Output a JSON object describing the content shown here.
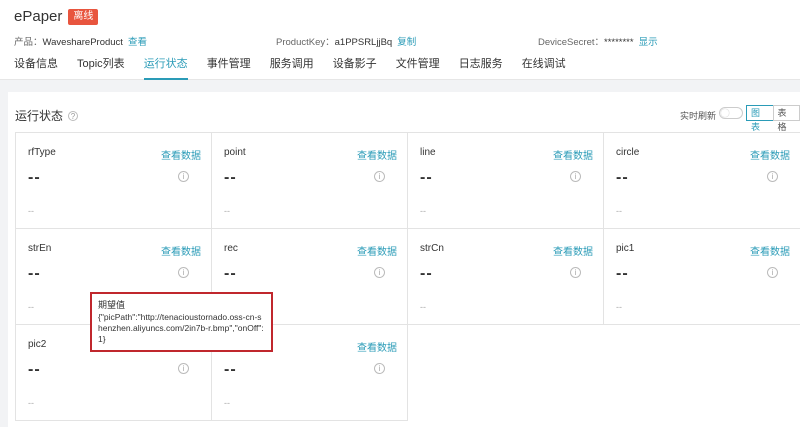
{
  "header": {
    "title": "ePaper",
    "badge": "离线",
    "product_label": "产品：",
    "product_value": "WaveshareProduct",
    "product_link": "查看",
    "productkey_label": "ProductKey：",
    "productkey_value": "a1PPSRLjjBq",
    "productkey_link": "复制",
    "secret_label": "DeviceSecret：",
    "secret_value": "********",
    "secret_link": "显示"
  },
  "tabs": [
    {
      "label": "设备信息"
    },
    {
      "label": "Topic列表"
    },
    {
      "label": "运行状态",
      "active": true
    },
    {
      "label": "事件管理"
    },
    {
      "label": "服务调用"
    },
    {
      "label": "设备影子"
    },
    {
      "label": "文件管理"
    },
    {
      "label": "日志服务"
    },
    {
      "label": "在线调试"
    }
  ],
  "section": {
    "title": "运行状态",
    "refresh_label": "实时刷新",
    "view_chart": "图表",
    "view_table": "表格"
  },
  "cards": [
    {
      "name": "rfType",
      "link": "查看数据",
      "value": "--",
      "time": "--"
    },
    {
      "name": "point",
      "link": "查看数据",
      "value": "--",
      "time": "--"
    },
    {
      "name": "line",
      "link": "查看数据",
      "value": "--",
      "time": "--"
    },
    {
      "name": "circle",
      "link": "查看数据",
      "value": "--",
      "time": "--"
    },
    {
      "name": "strEn",
      "link": "查看数据",
      "value": "--",
      "time": "--"
    },
    {
      "name": "rec",
      "link": "查看数据",
      "value": "--",
      "time": "--"
    },
    {
      "name": "strCn",
      "link": "查看数据",
      "value": "--",
      "time": "--"
    },
    {
      "name": "pic1",
      "link": "查看数据",
      "value": "--",
      "time": "--"
    },
    {
      "name": "pic2",
      "link": "",
      "value": "--",
      "time": "--"
    },
    {
      "name": "",
      "link": "查看数据",
      "value": "--",
      "time": "--"
    }
  ],
  "tooltip": {
    "title": "期望值",
    "body": "{\"picPath\":\"http://tenacioustornado.oss-cn-shenzhen.aliyuncs.com/2in7b-r.bmp\",\"onOff\":1}"
  }
}
